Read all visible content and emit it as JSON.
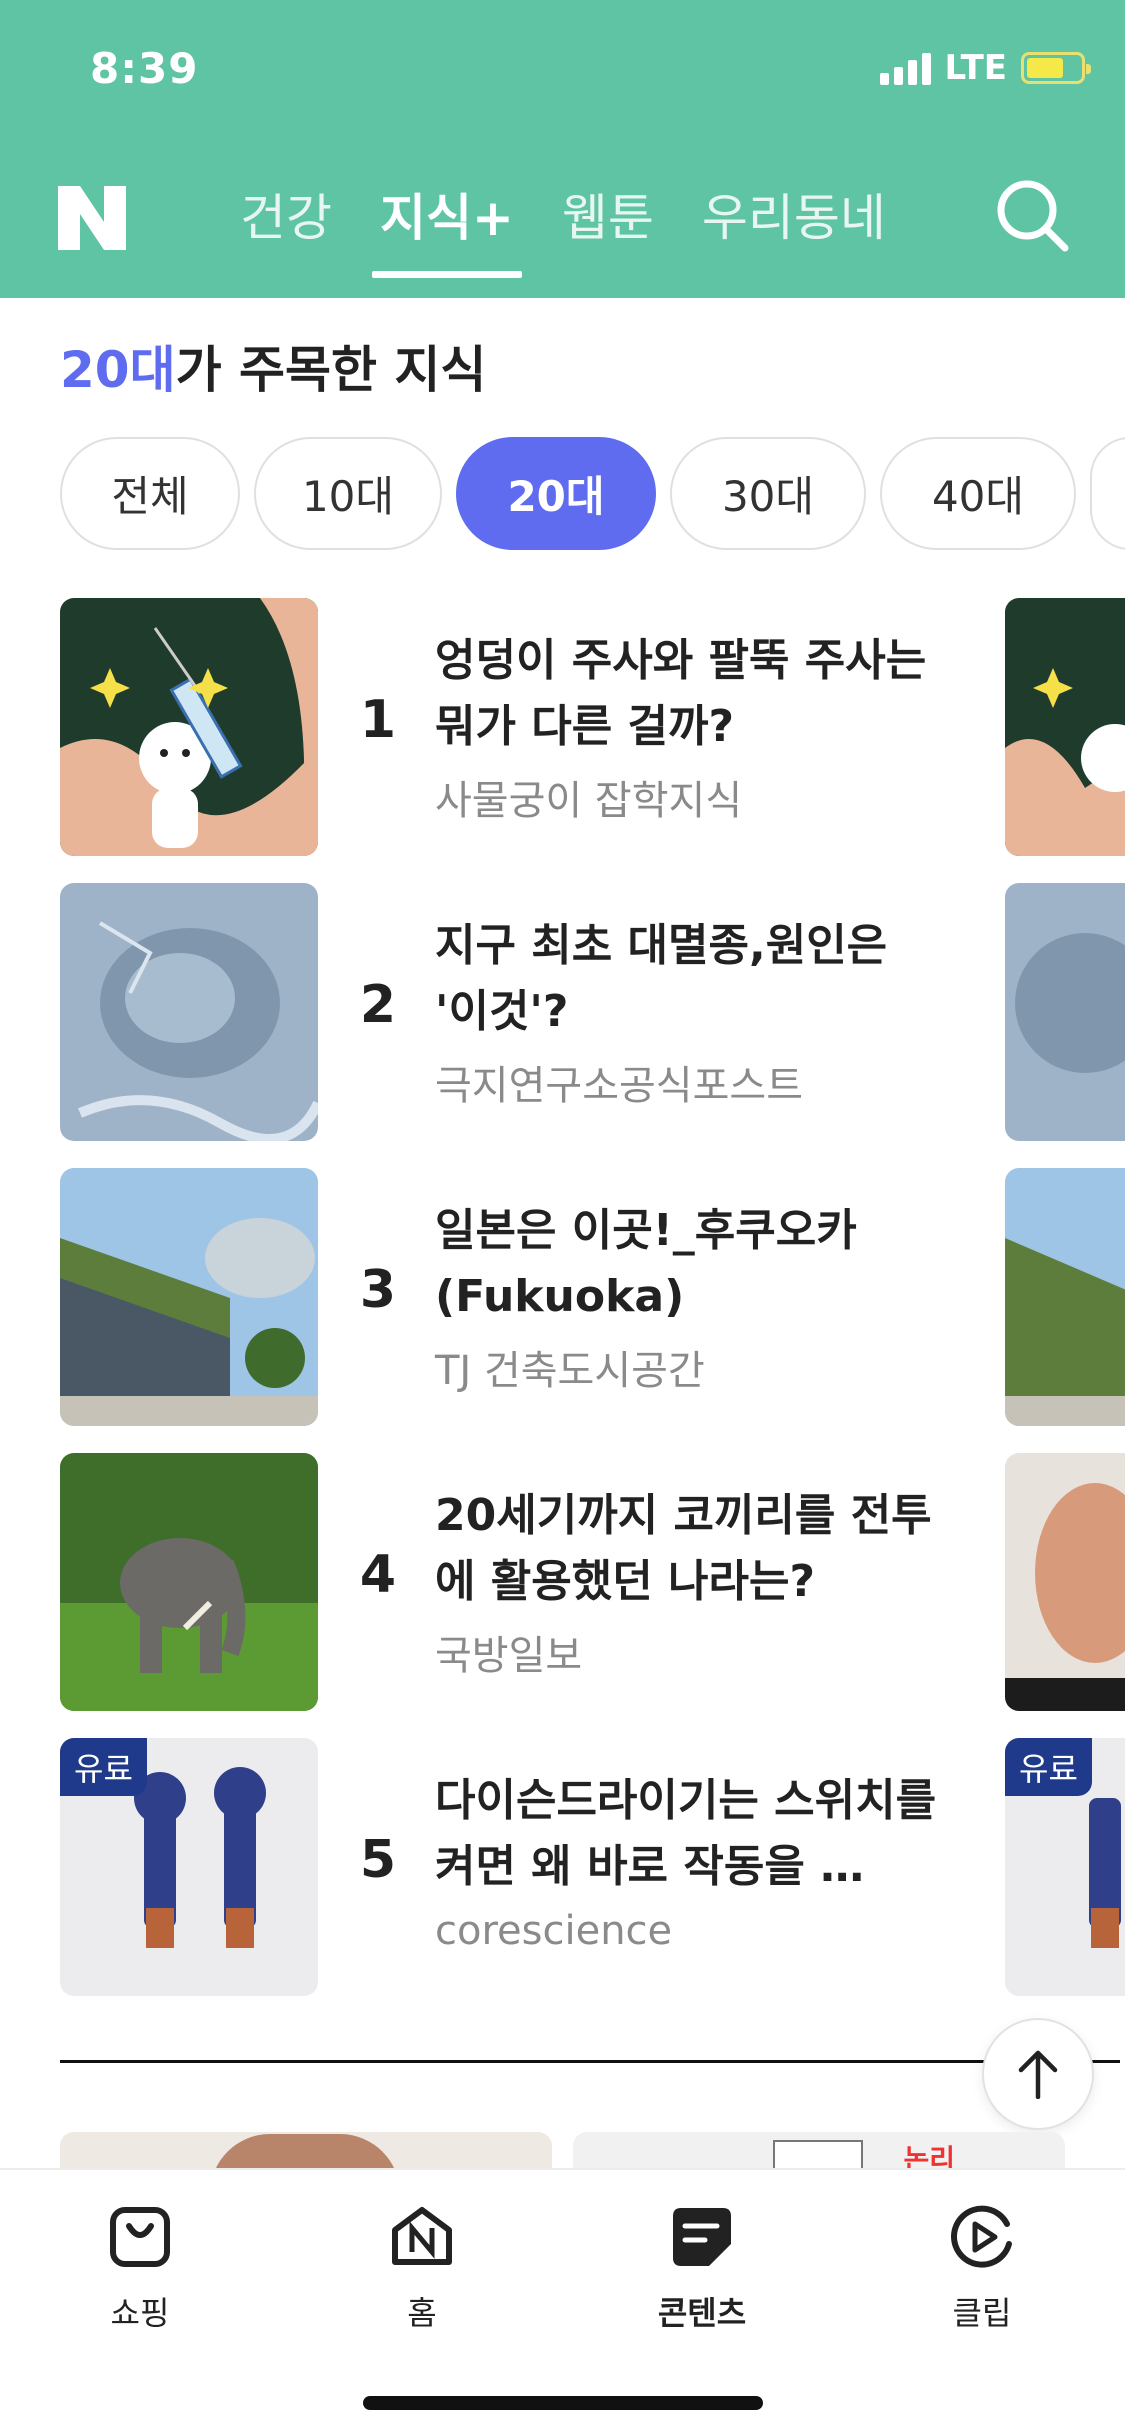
{
  "status": {
    "time": "8:39",
    "network": "LTE"
  },
  "header": {
    "logo": "N",
    "tabs": [
      {
        "label": "건강"
      },
      {
        "label": "지식+"
      },
      {
        "label": "웹툰"
      },
      {
        "label": "우리동네"
      }
    ],
    "active_tab": "지식+"
  },
  "section": {
    "title_highlight": "20대",
    "title_rest": "가 주목한 지식"
  },
  "chips": [
    "전체",
    "10대",
    "20대",
    "30대",
    "40대"
  ],
  "active_chip": "20대",
  "items": [
    {
      "rank": "1",
      "title": "엉덩이 주사와 팔뚝 주사는 뭐가 다른 걸까?",
      "source": "사물궁이 잡학지식"
    },
    {
      "rank": "2",
      "title": "지구 최초 대멸종,원인은 '이것'?",
      "source": "극지연구소공식포스트"
    },
    {
      "rank": "3",
      "title": "일본은 이곳!_후쿠오카(Fukuoka)",
      "source": "TJ 건축도시공간"
    },
    {
      "rank": "4",
      "title": "20세기까지 코끼리를 전투에 활용했던 나라는?",
      "source": "국방일보"
    },
    {
      "rank": "5",
      "title": "다이슨드라이기는 스위치를 켜면 왜 바로 작동을 …",
      "source": "corescience",
      "badge": "유료"
    }
  ],
  "right_peek_badge": "유료",
  "next_card_text": "논리",
  "bottom_nav": [
    {
      "label": "쇼핑",
      "icon": "shopping-bag-icon"
    },
    {
      "label": "홈",
      "icon": "home-icon"
    },
    {
      "label": "콘텐츠",
      "icon": "content-icon"
    },
    {
      "label": "클립",
      "icon": "clip-play-icon"
    }
  ],
  "active_bottom": "콘텐츠",
  "colors": {
    "header_bg": "#5ec4a3",
    "accent": "#5f6cf0",
    "paid_badge": "#1f3a8a"
  }
}
